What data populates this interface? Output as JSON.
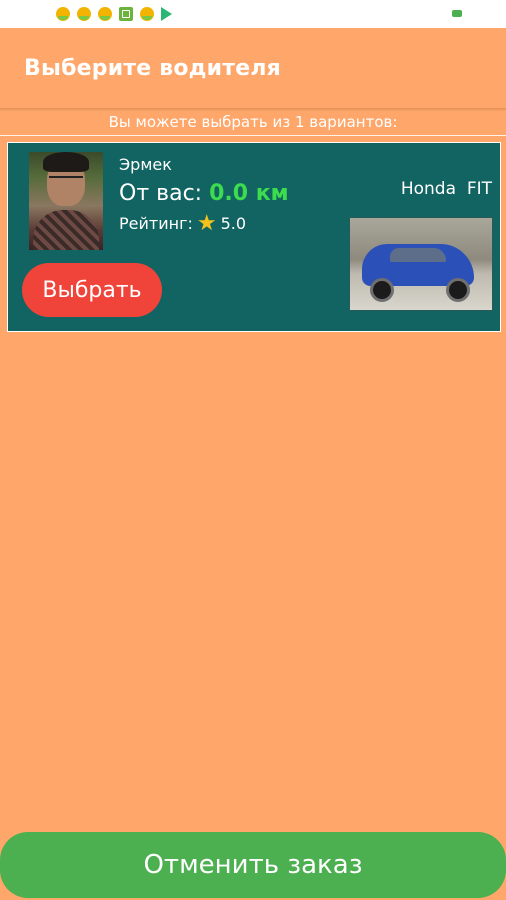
{
  "status_bar": {
    "icons": [
      "user-face-icon",
      "user-face-icon",
      "user-face-icon",
      "app-box-icon",
      "user-face-icon",
      "play-store-icon"
    ],
    "battery_color": "#4CAF50"
  },
  "app_bar": {
    "title": "Выберите водителя"
  },
  "list_header": "Вы можете выбрать из 1 вариантов:",
  "drivers": [
    {
      "name": "Эрмек",
      "distance_label": "От вас:",
      "distance_value": "0.0 км",
      "rating_label": "Рейтинг:",
      "rating_value": "5.0",
      "car_model": "Honda  FIT",
      "select_label": "Выбрать"
    }
  ],
  "footer": {
    "cancel_label": "Отменить заказ"
  },
  "colors": {
    "background": "#FFA76A",
    "card": "#116461",
    "distance_value": "#3DDC4F",
    "select_button": "#F0433A",
    "cancel_button": "#4CAF50",
    "star": "#F5C21B"
  }
}
